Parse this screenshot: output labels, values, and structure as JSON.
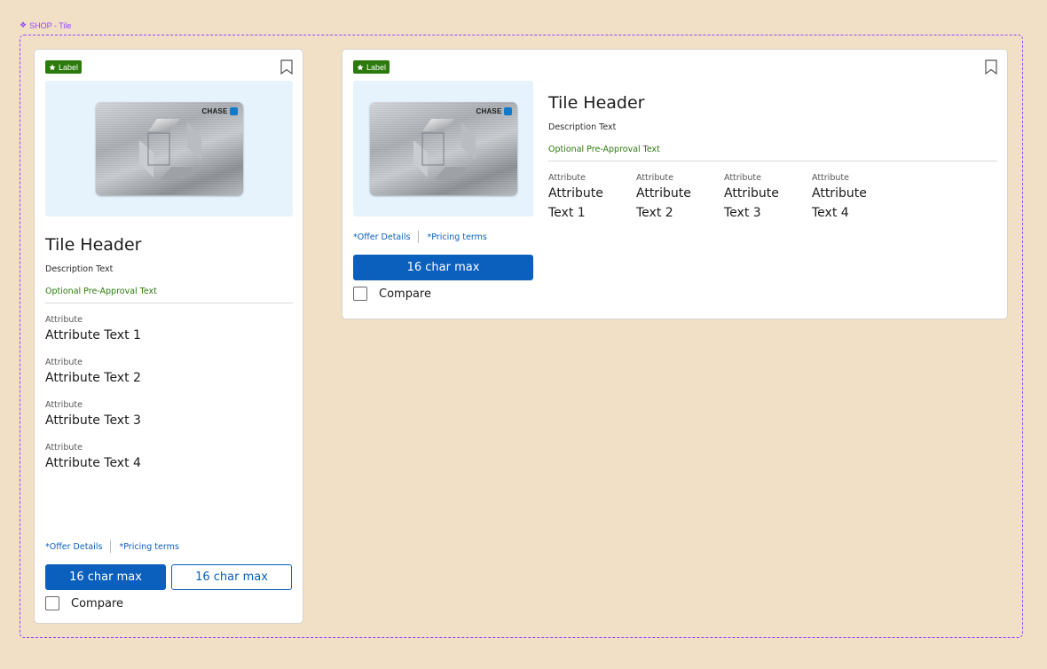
{
  "frame": {
    "label": "SHOP - Tile"
  },
  "colors": {
    "brand_blue": "#0b5fbd",
    "label_green": "#2b7a0b",
    "art_bg": "#e6f3fd",
    "canvas_bg": "#f1dfc6",
    "frame_purple": "#9747ff"
  },
  "vertical_tile": {
    "badge": "Label",
    "card_brand": "CHASE",
    "header": "Tile Header",
    "description": "Description Text",
    "pre_approval": "Optional Pre-Approval Text",
    "attributes": [
      {
        "label": "Attribute",
        "value": "Attribute Text 1"
      },
      {
        "label": "Attribute",
        "value": "Attribute Text 2"
      },
      {
        "label": "Attribute",
        "value": "Attribute Text 3"
      },
      {
        "label": "Attribute",
        "value": "Attribute Text 4"
      }
    ],
    "links": {
      "offer": "*Offer Details",
      "pricing": "*Pricing terms"
    },
    "primary_button": "16 char max",
    "secondary_button": "16 char max",
    "compare": "Compare"
  },
  "horizontal_tile": {
    "badge": "Label",
    "card_brand": "CHASE",
    "header": "Tile Header",
    "description": "Description Text",
    "pre_approval": "Optional Pre-Approval Text",
    "attributes": [
      {
        "label": "Attribute",
        "value_line1": "Attribute",
        "value_line2": "Text 1"
      },
      {
        "label": "Attribute",
        "value_line1": "Attribute",
        "value_line2": "Text 2"
      },
      {
        "label": "Attribute",
        "value_line1": "Attribute",
        "value_line2": "Text 3"
      },
      {
        "label": "Attribute",
        "value_line1": "Attribute",
        "value_line2": "Text 4"
      }
    ],
    "links": {
      "offer": "*Offer Details",
      "pricing": "*Pricing terms"
    },
    "primary_button": "16 char max",
    "compare": "Compare"
  },
  "icons": {
    "frame": "component-diamond-icon",
    "badge": "star-icon",
    "save": "bookmark-icon",
    "compare": "checkbox-unchecked"
  }
}
